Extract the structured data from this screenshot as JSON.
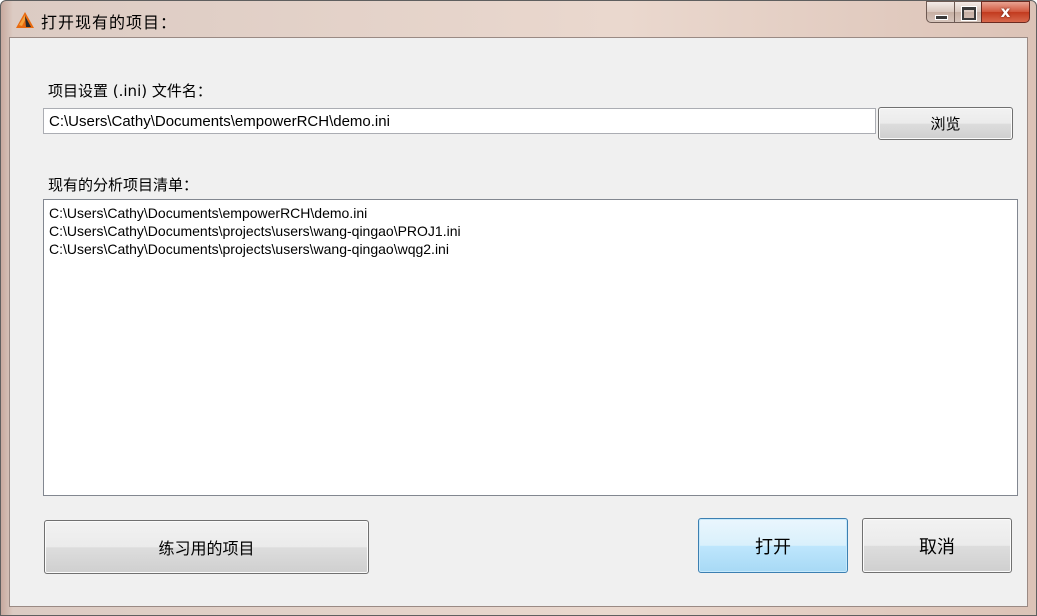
{
  "window": {
    "title": "打开现有的项目：",
    "icon": "app-logo-icon",
    "close_glyph": "x"
  },
  "file": {
    "label": "项目设置 (.ini) 文件名：",
    "value": "C:\\Users\\Cathy\\Documents\\empowerRCH\\demo.ini",
    "browse_label": "浏览"
  },
  "projects": {
    "label": "现有的分析项目清单：",
    "items": [
      "C:\\Users\\Cathy\\Documents\\empowerRCH\\demo.ini",
      "C:\\Users\\Cathy\\Documents\\projects\\users\\wang-qingao\\PROJ1.ini",
      "C:\\Users\\Cathy\\Documents\\projects\\users\\wang-qingao\\wqg2.ini"
    ]
  },
  "buttons": {
    "practice_label": "练习用的项目",
    "open_label": "打开",
    "cancel_label": "取消"
  },
  "colors": {
    "titlebar": "#ead8ce",
    "close_button": "#c23a1e",
    "default_button_border": "#3c7fb1"
  }
}
